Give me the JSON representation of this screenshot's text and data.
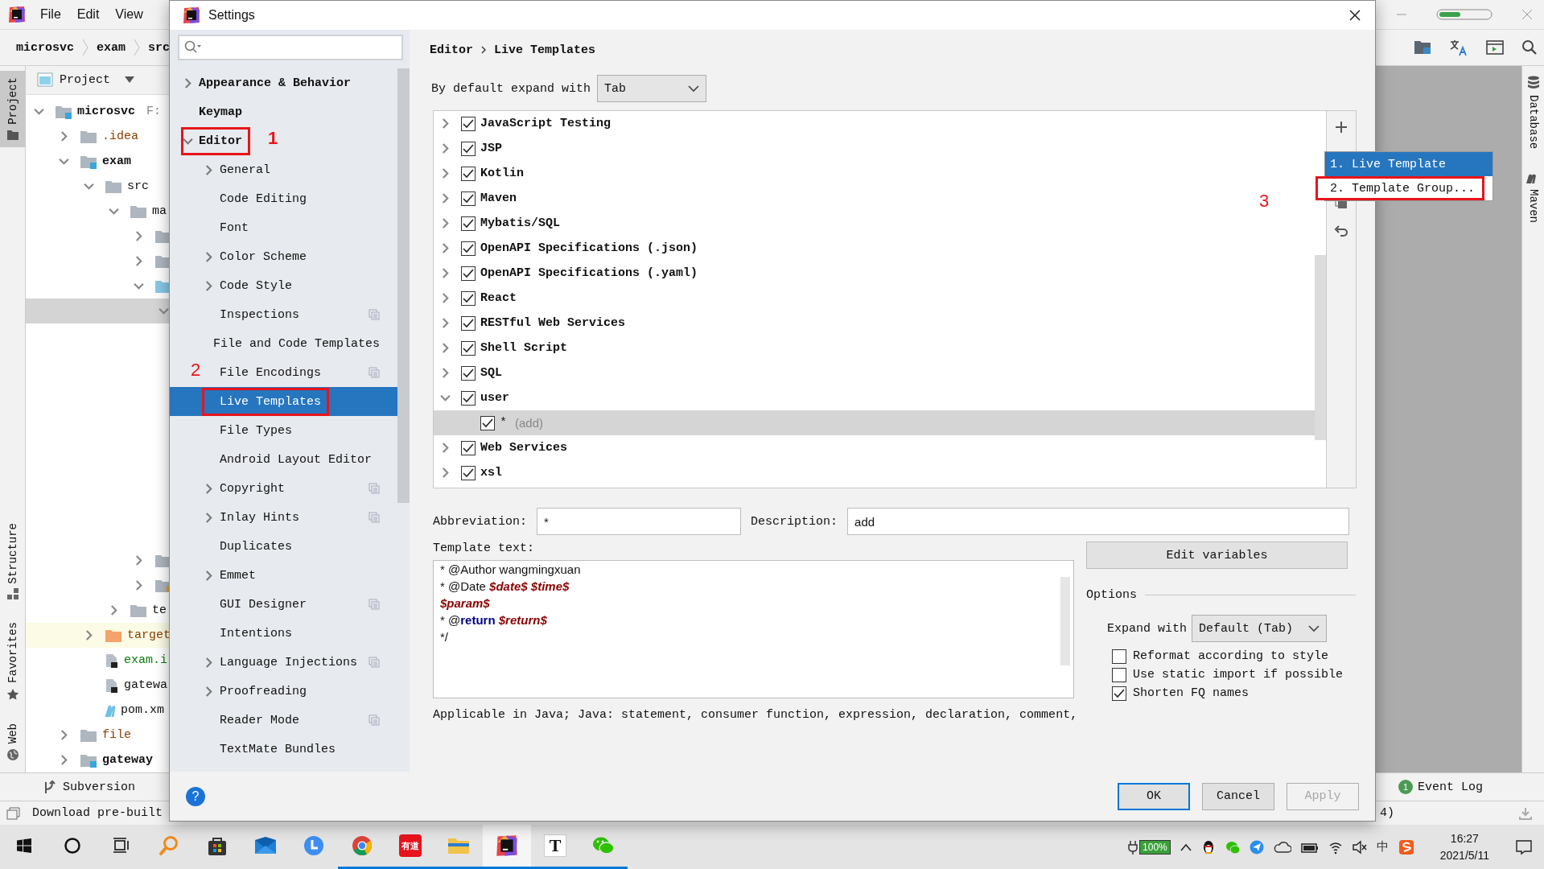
{
  "ide": {
    "menu": [
      "File",
      "Edit",
      "View"
    ],
    "breadcrumbs": [
      "microsvc",
      "exam",
      "src"
    ],
    "left_stripe": [
      {
        "label": "Project",
        "kind": "project",
        "selected": true
      },
      {
        "label": "Structure",
        "kind": "structure",
        "selected": false
      },
      {
        "label": "Favorites",
        "kind": "favorites",
        "selected": false
      },
      {
        "label": "Web",
        "kind": "web",
        "selected": false
      }
    ],
    "project_panel": {
      "title": "Project",
      "tree": [
        {
          "label": "microsvc",
          "hint": "F:",
          "kind": "module",
          "expandable": true,
          "expanded": true,
          "selected": false,
          "children": [
            {
              "label": ".idea",
              "kind": "folder",
              "color": "#8c3d00",
              "expandable": true,
              "expanded": false,
              "selected": false
            },
            {
              "label": "exam",
              "kind": "module",
              "expandable": true,
              "expanded": true,
              "selected": false,
              "children": [
                {
                  "label": "src",
                  "kind": "folder",
                  "expandable": true,
                  "expanded": true,
                  "selected": false,
                  "children": [
                    {
                      "label": "ma",
                      "kind": "folder",
                      "expandable": true,
                      "expanded": true,
                      "selected": false,
                      "children": [
                        {
                          "kind": "folder",
                          "expandable": true,
                          "expanded": false,
                          "selected": false
                        },
                        {
                          "kind": "folder",
                          "expandable": true,
                          "expanded": false,
                          "selected": false
                        },
                        {
                          "kind": "source",
                          "expandable": true,
                          "expanded": true,
                          "selected": false,
                          "children": [
                            {
                              "expandable": true,
                              "expanded": true,
                              "selected": true
                            }
                          ]
                        },
                        {
                          "kind": "folder",
                          "expandable": true,
                          "expanded": false,
                          "selected": false
                        },
                        {
                          "kind": "resources",
                          "expandable": true,
                          "expanded": false,
                          "selected": false
                        }
                      ]
                    },
                    {
                      "label": "te",
                      "kind": "folder",
                      "expandable": true,
                      "expanded": false,
                      "selected": false
                    }
                  ]
                },
                {
                  "label": "target",
                  "kind": "excluded",
                  "color": "#8c3d00",
                  "expandable": true,
                  "expanded": false,
                  "selected": false
                },
                {
                  "label": "exam.i",
                  "kind": "iml",
                  "color": "#0a7d0a",
                  "selected": false
                },
                {
                  "label": "gatewa",
                  "kind": "iml",
                  "selected": false
                },
                {
                  "label": "pom.xm",
                  "kind": "maven",
                  "selected": false
                }
              ]
            },
            {
              "label": "file",
              "kind": "folder",
              "color": "#8c3d00",
              "expandable": true,
              "expanded": false,
              "selected": false
            },
            {
              "label": "gateway",
              "kind": "module",
              "expandable": true,
              "expanded": false,
              "selected": false
            }
          ]
        }
      ]
    },
    "right_stripe": [
      {
        "label": "Database",
        "kind": "database"
      },
      {
        "label": "Maven",
        "kind": "maven"
      }
    ],
    "bottom_tools": [
      {
        "label": "Subversion"
      }
    ],
    "event_log": {
      "badge": "1",
      "label": "Event Log"
    },
    "status": {
      "message": "Download pre-built",
      "tail": "4)"
    }
  },
  "dialog": {
    "title": "Settings",
    "sidebar": [
      {
        "label": "Appearance & Behavior",
        "expandable": true,
        "expanded": false,
        "selected": false
      },
      {
        "label": "Keymap",
        "selected": false
      },
      {
        "label": "Editor",
        "expandable": true,
        "expanded": true,
        "selected": false,
        "outlined": true,
        "children": [
          {
            "label": "General",
            "expandable": true,
            "expanded": false,
            "selected": false
          },
          {
            "label": "Code Editing",
            "selected": false
          },
          {
            "label": "Font",
            "selected": false
          },
          {
            "label": "Color Scheme",
            "expandable": true,
            "expanded": false,
            "selected": false
          },
          {
            "label": "Code Style",
            "expandable": true,
            "expanded": false,
            "selected": false
          },
          {
            "label": "Inspections",
            "selected": false,
            "scope_icon": true
          },
          {
            "label": "File and Code Templates",
            "selected": false
          },
          {
            "label": "File Encodings",
            "selected": false,
            "scope_icon": true
          },
          {
            "label": "Live Templates",
            "selected": true,
            "outlined": true
          },
          {
            "label": "File Types",
            "selected": false
          },
          {
            "label": "Android Layout Editor",
            "selected": false
          },
          {
            "label": "Copyright",
            "expandable": true,
            "expanded": false,
            "selected": false,
            "scope_icon": true
          },
          {
            "label": "Inlay Hints",
            "expandable": true,
            "expanded": false,
            "selected": false,
            "scope_icon": true
          },
          {
            "label": "Duplicates",
            "selected": false
          },
          {
            "label": "Emmet",
            "expandable": true,
            "expanded": false,
            "selected": false
          },
          {
            "label": "GUI Designer",
            "selected": false,
            "scope_icon": true
          },
          {
            "label": "Intentions",
            "selected": false
          },
          {
            "label": "Language Injections",
            "expandable": true,
            "expanded": false,
            "selected": false,
            "scope_icon": true
          },
          {
            "label": "Proofreading",
            "expandable": true,
            "expanded": false,
            "selected": false
          },
          {
            "label": "Reader Mode",
            "selected": false,
            "scope_icon": true
          },
          {
            "label": "TextMate Bundles",
            "selected": false
          }
        ]
      }
    ],
    "breadcrumb": [
      "Editor",
      "Live Templates"
    ],
    "expand_default": {
      "label": "By default expand with",
      "value": "Tab"
    },
    "template_groups": [
      {
        "name": "JavaScript Testing",
        "checked": true,
        "expanded": false
      },
      {
        "name": "JSP",
        "checked": true,
        "expanded": false
      },
      {
        "name": "Kotlin",
        "checked": true,
        "expanded": false
      },
      {
        "name": "Maven",
        "checked": true,
        "expanded": false
      },
      {
        "name": "Mybatis/SQL",
        "checked": true,
        "expanded": false
      },
      {
        "name": "OpenAPI Specifications (.json)",
        "checked": true,
        "expanded": false
      },
      {
        "name": "OpenAPI Specifications (.yaml)",
        "checked": true,
        "expanded": false
      },
      {
        "name": "React",
        "checked": true,
        "expanded": false
      },
      {
        "name": "RESTful Web Services",
        "checked": true,
        "expanded": false
      },
      {
        "name": "Shell Script",
        "checked": true,
        "expanded": false
      },
      {
        "name": "SQL",
        "checked": true,
        "expanded": false
      },
      {
        "name": "user",
        "checked": true,
        "expanded": true,
        "children": [
          {
            "abbreviation": "*",
            "description": "(add)",
            "checked": true,
            "selected": true
          }
        ]
      },
      {
        "name": "Web Services",
        "checked": true,
        "expanded": false
      },
      {
        "name": "xsl",
        "checked": true,
        "expanded": false
      }
    ],
    "popup_menu": [
      {
        "label": "1. Live Template",
        "selected": true
      },
      {
        "label": "2. Template Group...",
        "selected": false,
        "outlined": true
      }
    ],
    "annotations": [
      {
        "label": "1"
      },
      {
        "label": "2"
      },
      {
        "label": "3"
      }
    ],
    "abbreviation": {
      "label": "Abbreviation:",
      "value": "*"
    },
    "description": {
      "label": "Description:",
      "value": "add"
    },
    "template_text": {
      "label": "Template text:",
      "lines": [
        [
          {
            "kind": "plain",
            "text": "* @Author wangmingxuan"
          }
        ],
        [
          {
            "kind": "plain",
            "text": "* @Date "
          },
          {
            "kind": "variable",
            "text": "$date$"
          },
          {
            "kind": "variable",
            "text": " $time$"
          }
        ],
        [
          {
            "kind": "variable",
            "text": "$param$"
          }
        ],
        [
          {
            "kind": "plain",
            "text": "* @"
          },
          {
            "kind": "keyword",
            "text": "return"
          },
          {
            "kind": "variable",
            "text": " $return$"
          }
        ],
        [
          {
            "kind": "plain",
            "text": "*/"
          }
        ]
      ]
    },
    "edit_variables": "Edit variables",
    "options": {
      "title": "Options",
      "expand_label": "Expand with",
      "expand_value": "Default (Tab)",
      "checkboxes": [
        {
          "label": "Reformat according to style",
          "checked": false
        },
        {
          "label": "Use static import if possible",
          "checked": false
        },
        {
          "label": "Shorten FQ names",
          "checked": true
        }
      ]
    },
    "applicable": "Applicable in Java; Java: statement, consumer function, expression, declaration, comment,",
    "help": "?",
    "buttons": [
      {
        "label": "OK",
        "default": true,
        "disabled": false
      },
      {
        "label": "Cancel",
        "default": false,
        "disabled": false
      },
      {
        "label": "Apply",
        "default": false,
        "disabled": true
      }
    ]
  },
  "taskbar": {
    "apps": [
      {
        "kind": "start",
        "running": false,
        "selected": false
      },
      {
        "kind": "cortana",
        "running": false,
        "selected": false
      },
      {
        "kind": "taskview",
        "running": false,
        "selected": false
      },
      {
        "kind": "search",
        "running": false,
        "selected": false
      },
      {
        "kind": "store",
        "running": false,
        "selected": false
      },
      {
        "kind": "mail",
        "running": false,
        "selected": false
      },
      {
        "kind": "clock",
        "running": false,
        "selected": false
      },
      {
        "kind": "chrome",
        "running": true,
        "selected": false
      },
      {
        "kind": "youdao",
        "label": "有道",
        "running": true,
        "selected": false
      },
      {
        "kind": "explorer",
        "running": true,
        "selected": false
      },
      {
        "kind": "intellij",
        "running": true,
        "selected": true
      },
      {
        "kind": "typora",
        "label": "T",
        "running": true,
        "selected": false
      },
      {
        "kind": "wechat",
        "running": true,
        "selected": false
      }
    ],
    "battery": "100%",
    "ime": "中",
    "time": "16:27",
    "date": "2021/5/11"
  }
}
